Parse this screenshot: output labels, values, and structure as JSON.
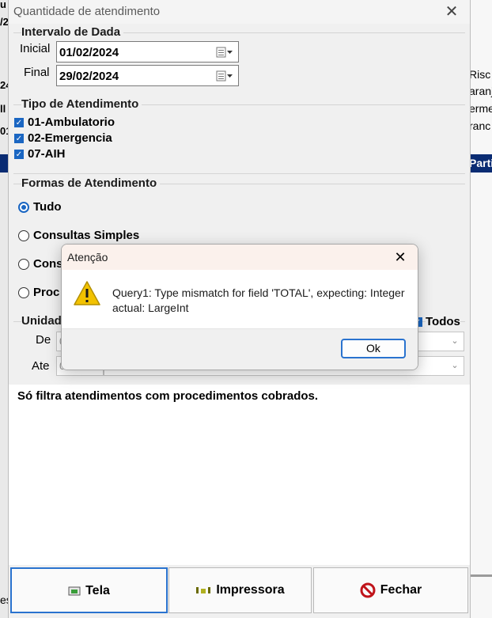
{
  "background_app": {
    "left_fragments": [
      "u",
      "/2",
      "24",
      "ll",
      "01"
    ],
    "right_fragments": [
      "Risc",
      "aranj",
      "erme",
      "ranc"
    ],
    "navy_bar_text": "Parti",
    "bottom_left_text": "es"
  },
  "dialog": {
    "title": "Quantidade de atendimento",
    "close_icon": "close-icon",
    "interval": {
      "title": "Intervalo de Dada",
      "start_label": "Inicial",
      "start_value": "01/02/2024",
      "end_label": "Final",
      "end_value": "29/02/2024"
    },
    "types": {
      "title": "Tipo de Atendimento",
      "items": [
        {
          "label": "01-Ambulatorio",
          "checked": true
        },
        {
          "label": "02-Emergencia",
          "checked": true
        },
        {
          "label": "07-AIH",
          "checked": true
        }
      ]
    },
    "forms": {
      "title": "Formas de Atendimento",
      "options": [
        {
          "label": "Tudo",
          "selected": true
        },
        {
          "label": "Consultas Simples",
          "selected": false
        },
        {
          "label": "Cons",
          "selected": false
        },
        {
          "label": "Proc",
          "selected": false
        }
      ]
    },
    "unit": {
      "title": "Unidad",
      "todos_label": "Todos",
      "todos_checked": true,
      "de_label": "De",
      "ate_label": "Ate",
      "de_value": "0",
      "ate_value": "0"
    },
    "note": "Só filtra atendimentos com procedimentos cobrados.",
    "buttons": {
      "tela": "Tela",
      "impressora": "Impressora",
      "fechar": "Fechar"
    }
  },
  "alert": {
    "title": "Atenção",
    "message": "Query1: Type mismatch for field 'TOTAL', expecting: Integer actual: LargeInt",
    "ok_label": "Ok",
    "icon": "warning-icon"
  },
  "colors": {
    "accent": "#1a66c2",
    "navy": "#0a2c73",
    "warning": "#f2c200"
  }
}
